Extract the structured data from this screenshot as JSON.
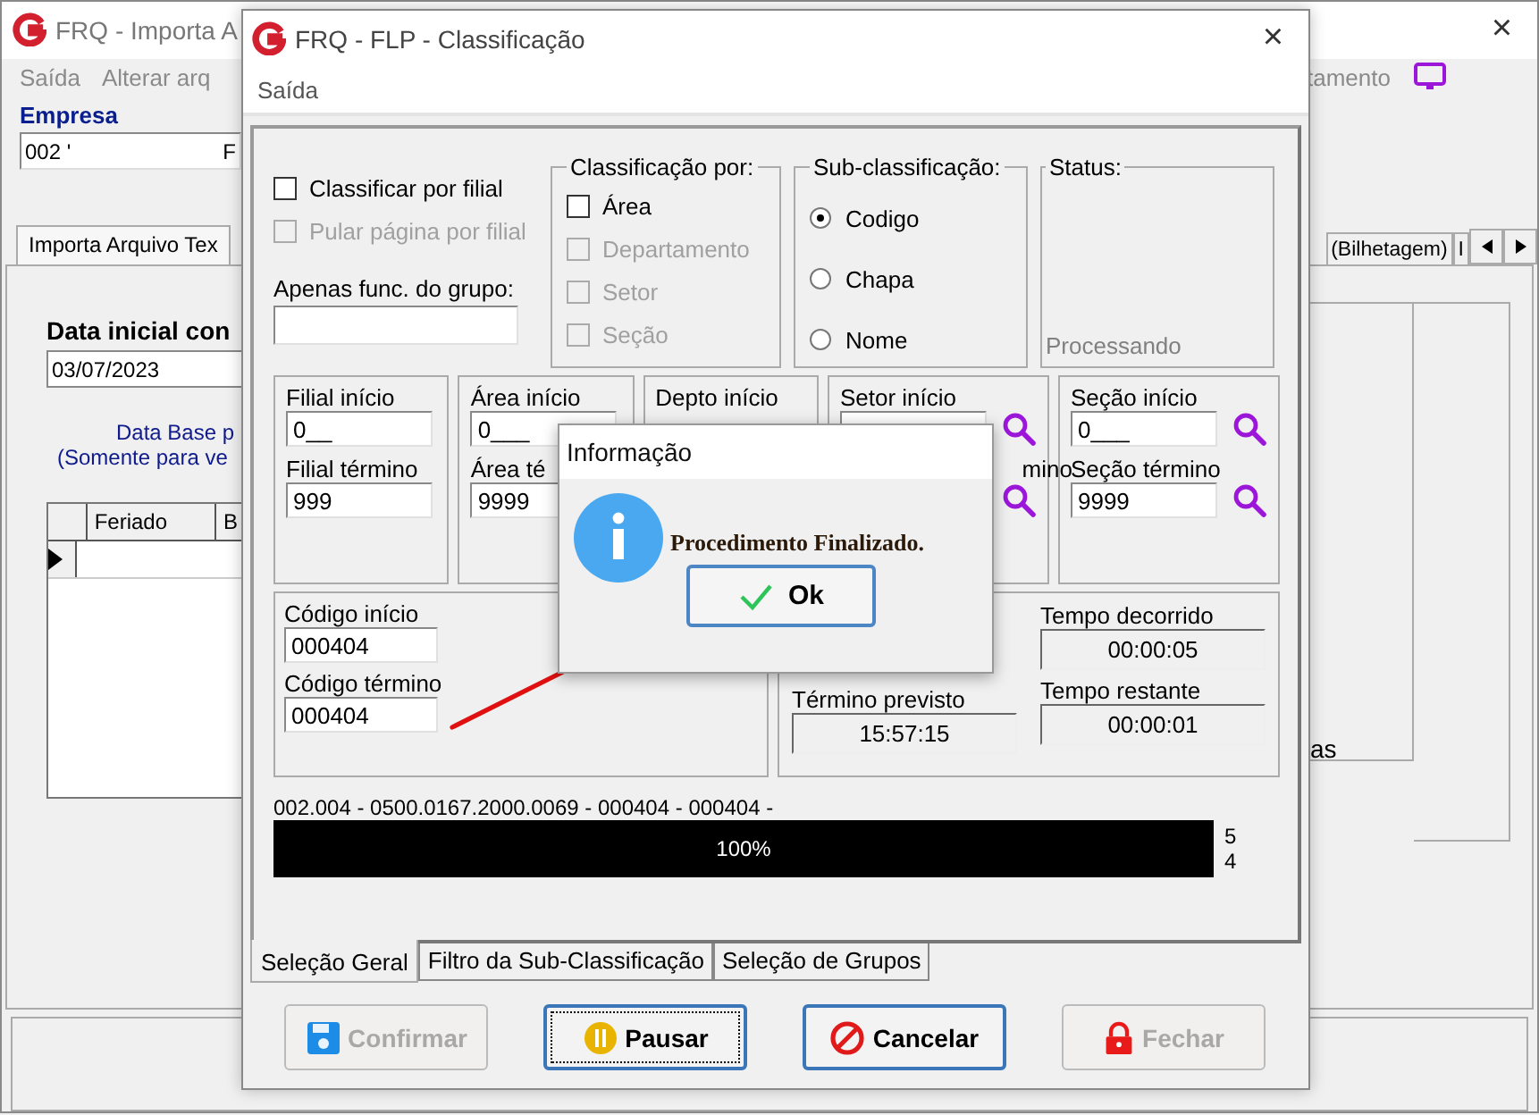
{
  "background_window": {
    "title": "FRQ - Importa A",
    "close": "×",
    "menu_left": [
      "Saída",
      "Alterar arq"
    ],
    "menu_right": "tamento",
    "company_label": "Empresa",
    "company_value": "002 '",
    "company_suffix": "F",
    "tabs": [
      {
        "label": "Importa Arquivo Tex",
        "selected": true
      },
      {
        "label": "(Bilhetagem)",
        "selected": false
      },
      {
        "label": "I",
        "selected": false
      }
    ],
    "date_label": "Data inicial con",
    "date_value": "03/07/2023",
    "note_lines": [
      "Data Base p",
      "(Somente para ve"
    ],
    "grid_columns": [
      "Feriado",
      "B"
    ],
    "side_text": "as"
  },
  "dialog": {
    "title": "FRQ - FLP - Classificação",
    "close": "×",
    "menu": [
      "Saída"
    ],
    "options": [
      {
        "label": "Classificar por filial",
        "checked": false,
        "disabled": false
      },
      {
        "label": "Pular página por filial",
        "checked": false,
        "disabled": true
      }
    ],
    "group_filter": {
      "label": "Apenas func. do grupo:"
    },
    "classification": {
      "title": "Classificação  por:",
      "items": [
        {
          "label": "Área",
          "checked": false,
          "disabled": false
        },
        {
          "label": "Departamento",
          "checked": false,
          "disabled": true
        },
        {
          "label": "Setor",
          "checked": false,
          "disabled": true
        },
        {
          "label": "Seção",
          "checked": false,
          "disabled": true
        }
      ]
    },
    "sub_classification": {
      "title": "Sub-classificação:",
      "options": [
        {
          "label": "Codigo",
          "selected": true
        },
        {
          "label": "Chapa",
          "selected": false
        },
        {
          "label": "Nome",
          "selected": false
        }
      ]
    },
    "status": {
      "title": "Status:",
      "text": "Processando"
    },
    "ranges": [
      {
        "start_label": "Filial início",
        "start_value": "0__",
        "end_label": "Filial término",
        "end_value": "999",
        "search": false
      },
      {
        "start_label": "Área início",
        "start_value": "0___",
        "end_label": "Área té",
        "end_value": "9999",
        "search": false
      },
      {
        "start_label": "Depto início",
        "search": false
      },
      {
        "start_label": "Setor início",
        "end_label": "mino",
        "search": true
      },
      {
        "start_label": "Seção início",
        "start_value": "0___",
        "end_label": "Seção término",
        "end_value": "9999",
        "search": true
      }
    ],
    "code": {
      "start_label": "Código início",
      "start_value": "000404",
      "end_label": "Código término",
      "end_value": "000404"
    },
    "times_left": [
      {
        "label": "Término previsto",
        "value": "15:57:15"
      }
    ],
    "times_right": [
      {
        "label": "Tempo decorrido",
        "value": "00:00:05"
      },
      {
        "label": "Tempo restante",
        "value": "00:00:01"
      }
    ],
    "progress": {
      "text": "002.004 - 0500.0167.2000.0069 - 000404 - 000404 -",
      "level": 1,
      "reading": "100%",
      "side": [
        "5",
        "4"
      ]
    },
    "tabs": [
      {
        "label": "Seleção Geral",
        "selected": true
      },
      {
        "label": "Filtro da Sub-Classificação",
        "selected": false
      },
      {
        "label": "Seleção de Grupos",
        "selected": false
      }
    ],
    "buttons": [
      {
        "kind": "save",
        "label": "Confirmar",
        "disabled": true,
        "focused": false
      },
      {
        "kind": "pause",
        "label": "Pausar",
        "disabled": false,
        "focused": true
      },
      {
        "kind": "cancel",
        "label": "Cancelar",
        "disabled": false,
        "focused": false
      },
      {
        "kind": "lock",
        "label": "Fechar",
        "disabled": true,
        "focused": false
      }
    ]
  },
  "message_box": {
    "title": "Informação",
    "message": "Procedimento Finalizado.",
    "button": "Ok"
  }
}
